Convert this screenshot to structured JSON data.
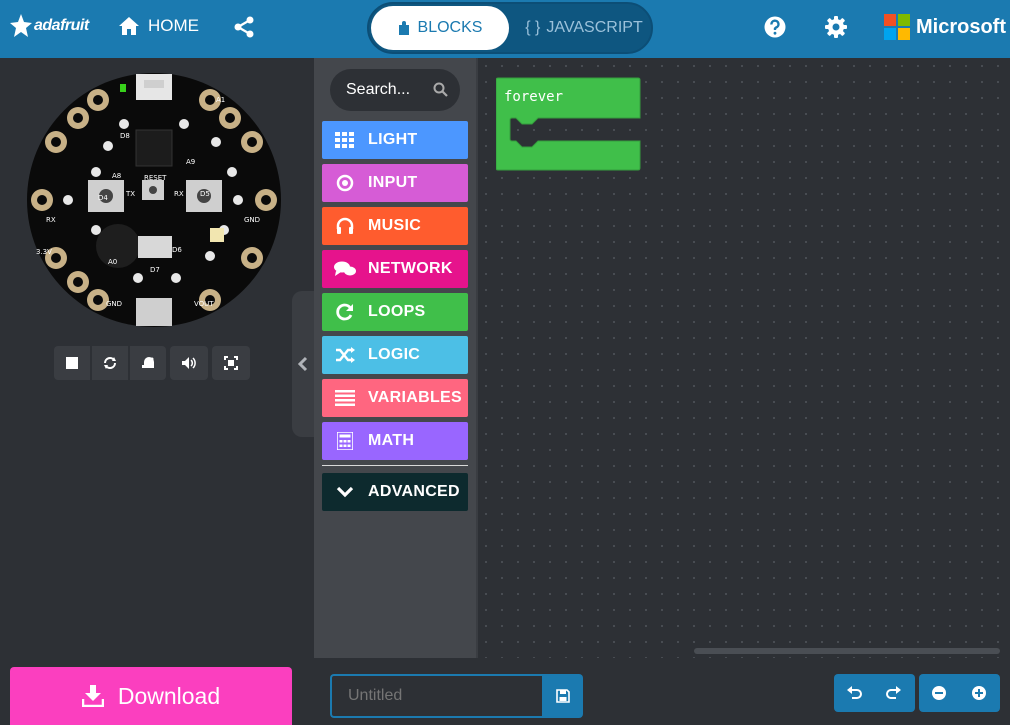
{
  "header": {
    "brand": "adafruit",
    "home_label": "HOME",
    "blocks_tab": "BLOCKS",
    "js_tab": "JAVASCRIPT",
    "js_glyph": "{ }",
    "microsoft": "Microsoft"
  },
  "toolbox": {
    "search_placeholder": "Search...",
    "categories": [
      {
        "label": "LIGHT",
        "color": "#4c97ff",
        "icon": "grid-icon"
      },
      {
        "label": "INPUT",
        "color": "#d65cd6",
        "icon": "target-icon"
      },
      {
        "label": "MUSIC",
        "color": "#ff5c2e",
        "icon": "headphones-icon"
      },
      {
        "label": "NETWORK",
        "color": "#e6138c",
        "icon": "chat-icon"
      },
      {
        "label": "LOOPS",
        "color": "#40bf4a",
        "icon": "refresh-icon"
      },
      {
        "label": "LOGIC",
        "color": "#4cbfe6",
        "icon": "shuffle-icon"
      },
      {
        "label": "VARIABLES",
        "color": "#ff6680",
        "icon": "list-icon"
      },
      {
        "label": "MATH",
        "color": "#9966ff",
        "icon": "calculator-icon"
      }
    ],
    "advanced_label": "ADVANCED",
    "advanced_color": "#0d2a2e"
  },
  "workspace": {
    "block_label": "forever",
    "block_color": "#40bf4a"
  },
  "footer": {
    "download_label": "Download",
    "project_name_placeholder": "Untitled"
  },
  "colors": {
    "header": "#1b7ab0",
    "download": "#fb3fbf"
  }
}
